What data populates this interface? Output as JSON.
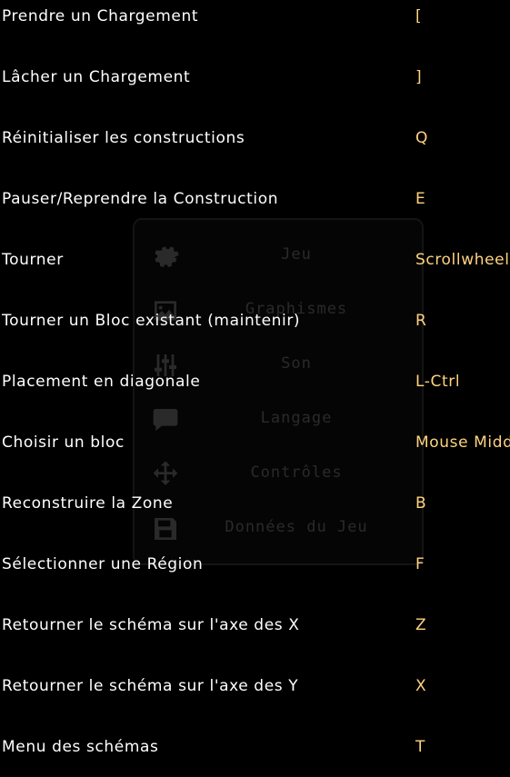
{
  "colors": {
    "background": "#000000",
    "action_text": "#ffffff",
    "key_text": "#ffd37f",
    "dim_menu_text": "#2a2a2a"
  },
  "settings_menu": {
    "items": [
      {
        "label": "Jeu",
        "icon": "gear-icon"
      },
      {
        "label": "Graphismes",
        "icon": "image-icon"
      },
      {
        "label": "Son",
        "icon": "sliders-icon"
      },
      {
        "label": "Langage",
        "icon": "chat-icon"
      },
      {
        "label": "Contrôles",
        "icon": "move-icon"
      },
      {
        "label": "Données du Jeu",
        "icon": "save-icon"
      }
    ]
  },
  "keybinds": [
    {
      "action": "Prendre un Chargement",
      "key": "["
    },
    {
      "action": "Lâcher un Chargement",
      "key": "]"
    },
    {
      "action": "Réinitialiser les constructions",
      "key": "Q"
    },
    {
      "action": "Pauser/Reprendre la Construction",
      "key": "E"
    },
    {
      "action": "Tourner",
      "key": "Scrollwheel"
    },
    {
      "action": "Tourner un Bloc existant (maintenir)",
      "key": "R"
    },
    {
      "action": "Placement en diagonale",
      "key": "L-Ctrl"
    },
    {
      "action": "Choisir un bloc",
      "key": "Mouse Middle"
    },
    {
      "action": "Reconstruire la Zone",
      "key": "B"
    },
    {
      "action": "Sélectionner une Région",
      "key": "F"
    },
    {
      "action": "Retourner le schéma sur l'axe des X",
      "key": "Z"
    },
    {
      "action": "Retourner le schéma sur l'axe des Y",
      "key": "X"
    },
    {
      "action": "Menu des schémas",
      "key": "T"
    }
  ]
}
